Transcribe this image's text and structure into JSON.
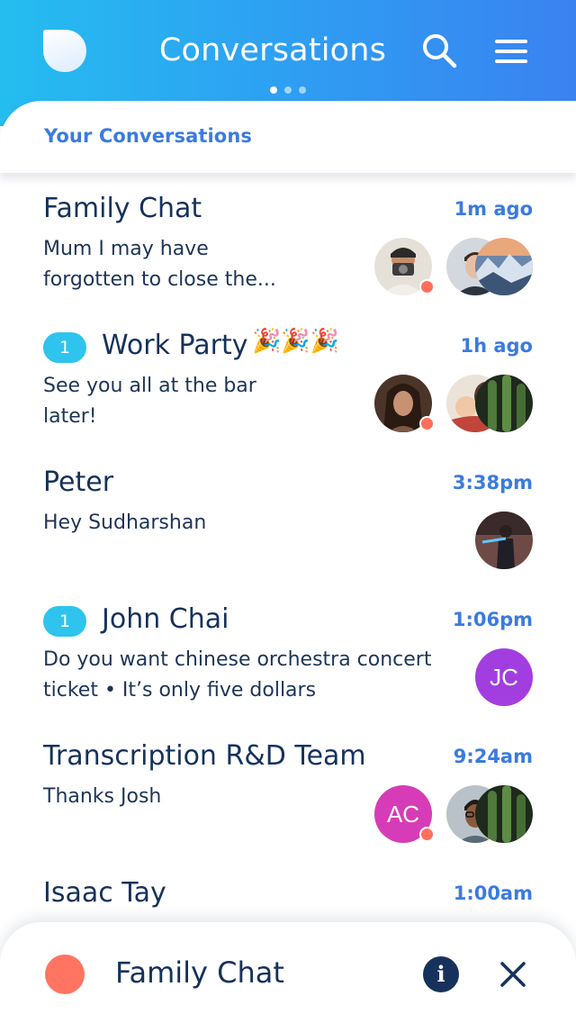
{
  "header": {
    "title": "Conversations",
    "icons": [
      "app-logo-icon",
      "search-icon",
      "hamburger-menu-icon"
    ],
    "page_indicator": {
      "count": 3,
      "active": 1
    }
  },
  "subheader": {
    "title": "Your Conversations"
  },
  "conversations": [
    {
      "name": "Family Chat",
      "time": "1m ago",
      "preview": "Mum I may have forgotten to close the...",
      "avatars": [
        "photo-camera-person",
        "photo-man",
        "photo-mountain"
      ]
    },
    {
      "name": "Work Party",
      "unread": "1",
      "emoji": "🎉🎉🎉",
      "time": "1h ago",
      "preview": "See you all at the bar later!",
      "avatars": [
        "photo-woman",
        "photo-baby",
        "photo-cactus"
      ]
    },
    {
      "name": "Peter",
      "time": "3:38pm",
      "preview": "Hey Sudharshan",
      "avatars": [
        "photo-person-dark"
      ]
    },
    {
      "name": "John Chai",
      "unread": "1",
      "time": "1:06pm",
      "preview": "Do you want chinese orchestra concert ticket • It’s only five dollars",
      "avatars": [
        "JC"
      ]
    },
    {
      "name": "Transcription R&D Team",
      "time": "9:24am",
      "preview": "Thanks Josh",
      "avatars": [
        "AC",
        "photo-man-glasses",
        "photo-cactus"
      ]
    },
    {
      "name": "Isaac Tay",
      "time": "1:00am"
    }
  ],
  "bottom_bar": {
    "title": "Family Chat",
    "icons": [
      "info-icon",
      "close-icon"
    ]
  },
  "colors": {
    "header_gradient_start": "#25bdf0",
    "header_gradient_end": "#3a82f0",
    "accent_blue": "#3b7be0",
    "navy": "#16325c",
    "badge": "#2ec4ee",
    "online_status": "#ff6f5c",
    "avatar_jc": "#a23ee0",
    "avatar_ac": "#d63cb7"
  }
}
